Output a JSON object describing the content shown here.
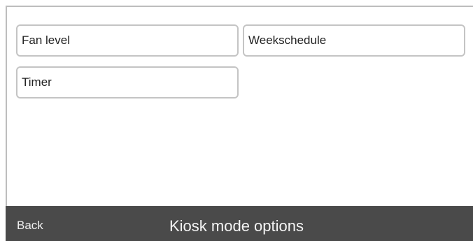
{
  "options": {
    "fan_level": "Fan level",
    "weekschedule": "Weekschedule",
    "timer": "Timer"
  },
  "footer": {
    "back_label": "Back",
    "title": "Kiosk mode options"
  },
  "colors": {
    "footer_bg": "#4a4a4a",
    "button_border": "#c4c4c4",
    "background": "#ffffff"
  }
}
